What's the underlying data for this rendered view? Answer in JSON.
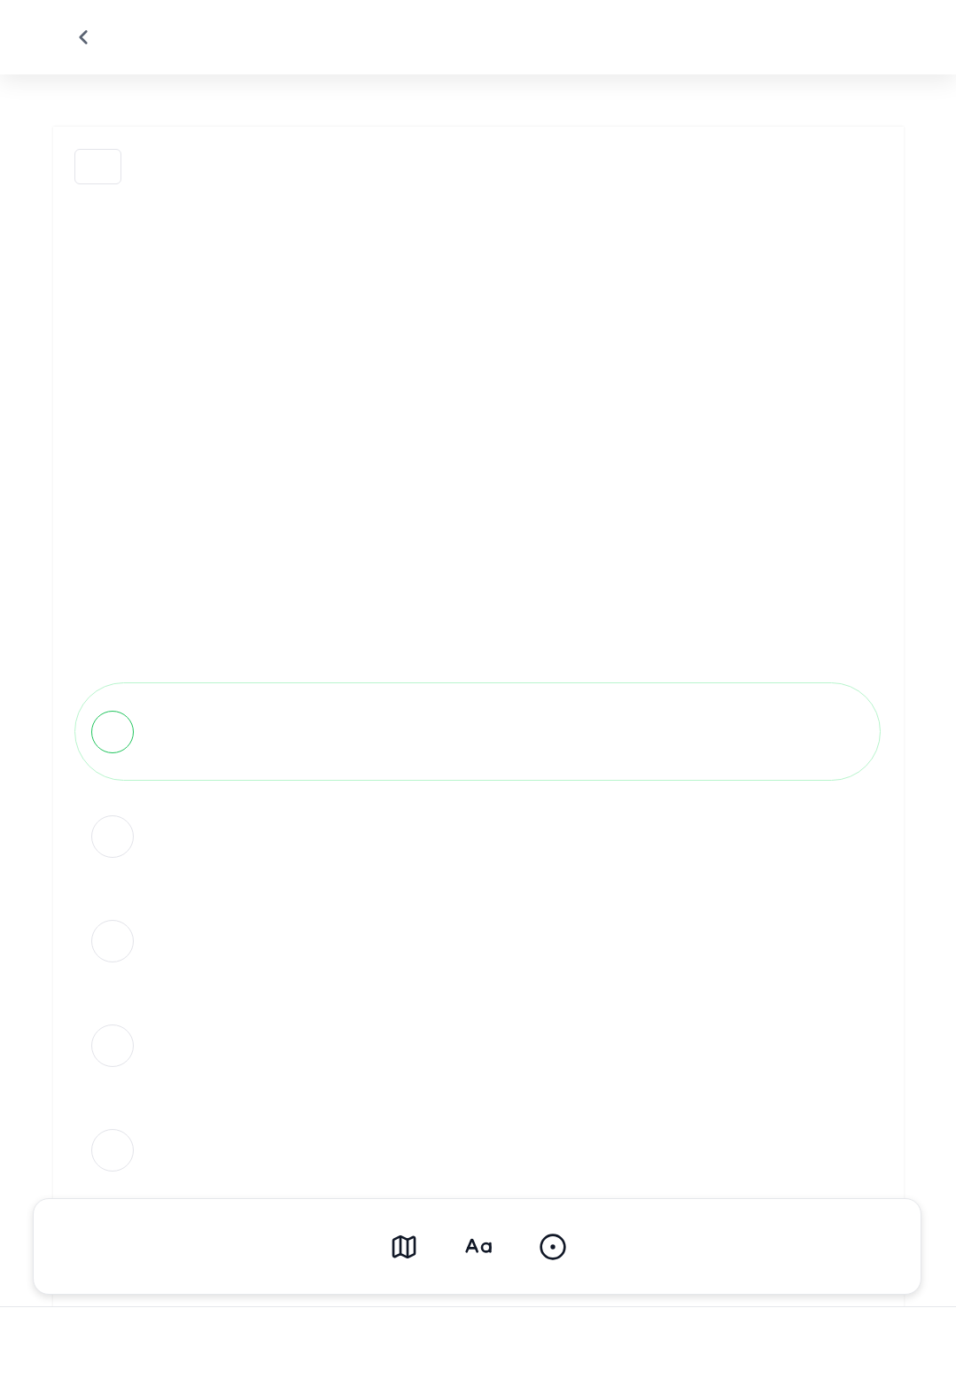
{
  "options": [
    {
      "selected": true
    },
    {
      "selected": false
    },
    {
      "selected": false
    },
    {
      "selected": false
    },
    {
      "selected": false
    }
  ],
  "toolbar": [
    {
      "kind": "map"
    },
    {
      "kind": "text-size"
    },
    {
      "kind": "target"
    }
  ]
}
